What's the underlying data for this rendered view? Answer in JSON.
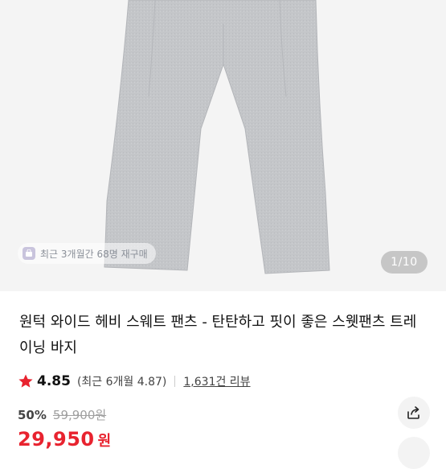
{
  "gallery": {
    "recent_purchase_badge": "최근 3개월간 68명 재구매",
    "page_counter": "1/10",
    "image_bg": "#f4f4f4",
    "product_color": "#c4c6c9"
  },
  "product": {
    "title": "원턱 와이드 헤비 스웨트 팬츠 - 탄탄하고 핏이 좋은 스웻팬츠 트레이닝 바지",
    "rating": "4.85",
    "recent_rating": "(최근 6개월 4.87)",
    "review_count": "1,631건 리뷰",
    "discount_percent": "50%",
    "original_price": "59,900원",
    "sale_price": "29,950",
    "currency": "원",
    "accent_color": "#e8232f",
    "star_color": "#e8232f"
  },
  "actions": {
    "share_icon": "share-icon"
  }
}
